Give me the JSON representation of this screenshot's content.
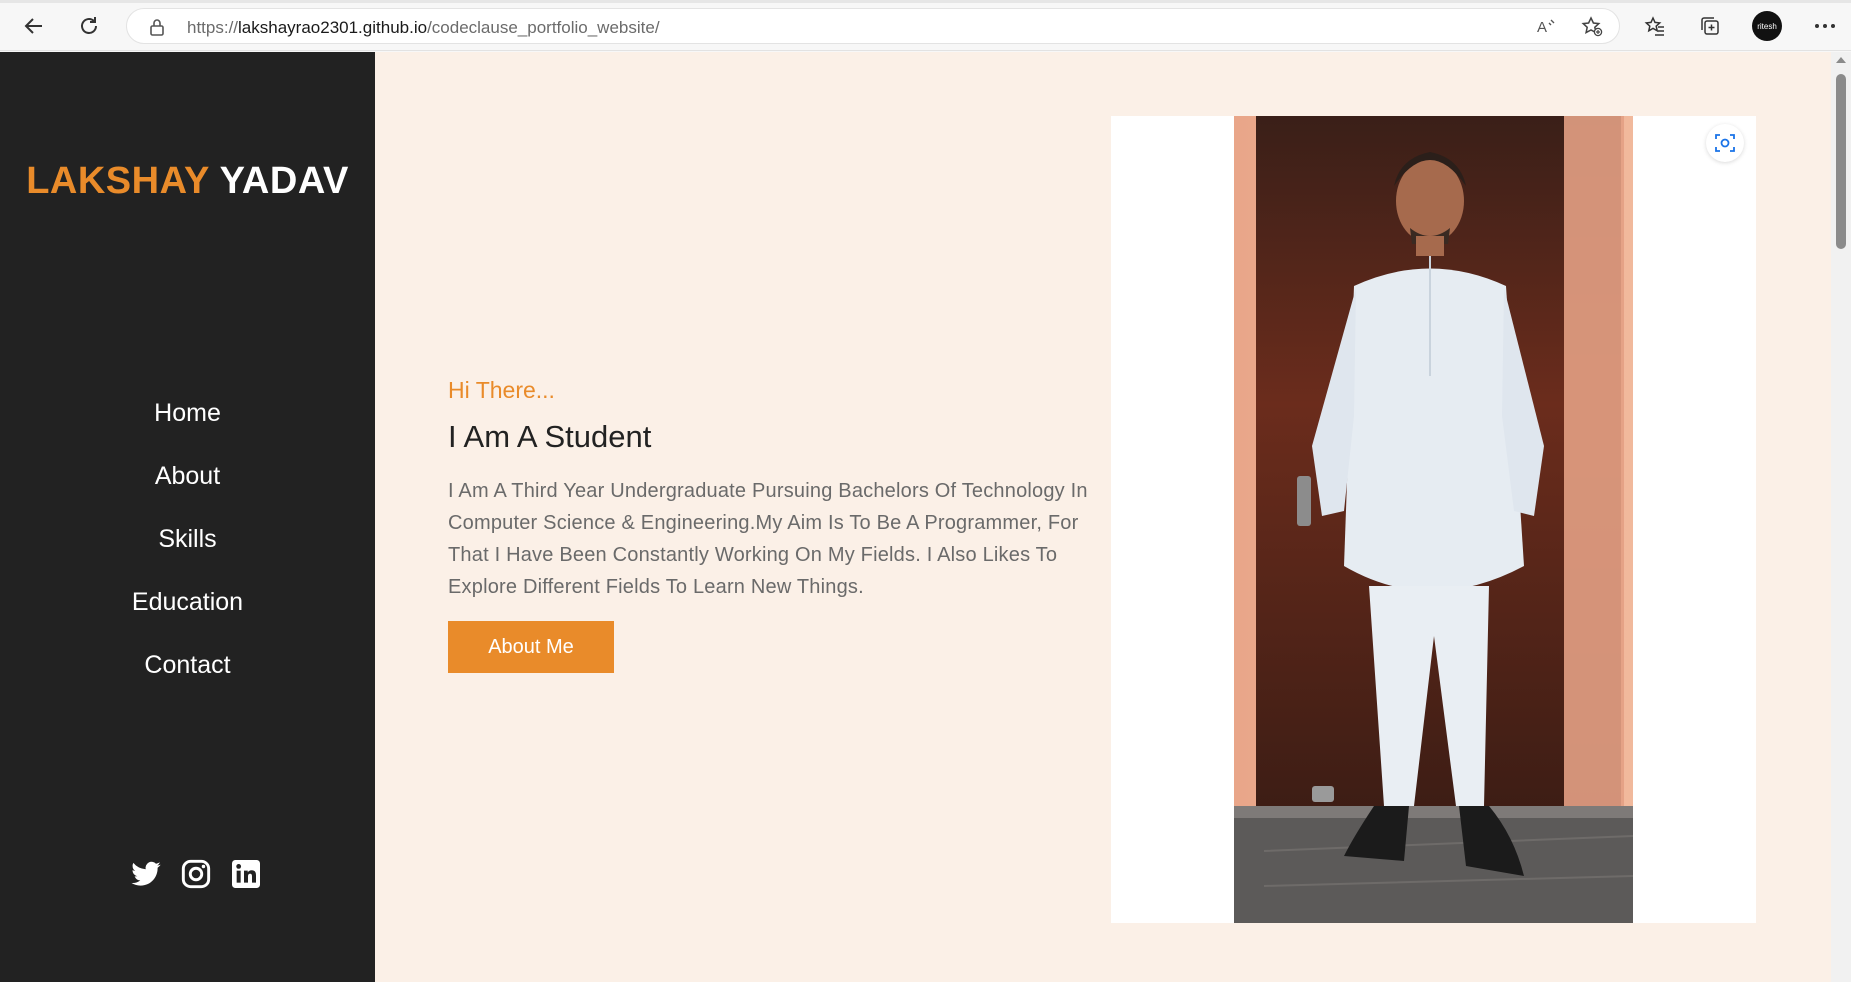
{
  "browser": {
    "url_prefix": "https://",
    "url_host": "lakshayrao2301.github.io",
    "url_path": "/codeclause_portfolio_website/",
    "avatar_text": "ritesh"
  },
  "sidebar": {
    "logo_first": "LAKSHAY",
    "logo_last": "YADAV",
    "nav": [
      "Home",
      "About",
      "Skills",
      "Education",
      "Contact"
    ],
    "social": [
      "twitter-icon",
      "instagram-icon",
      "linkedin-icon"
    ]
  },
  "hero": {
    "greeting": "Hi There...",
    "headline": "I Am A Student",
    "bio": "I Am A Third Year Undergraduate Pursuing Bachelors Of Technology In Computer Science & Engineering.My Aim Is To Be A Programmer, For That I Have Been Constantly Working On My Fields. I Also Likes To Explore Different Fields To Learn New Things.",
    "button": "About Me"
  },
  "colors": {
    "accent": "#e98b2a",
    "sidebar_bg": "#222222",
    "main_bg": "#fbf0e7"
  }
}
